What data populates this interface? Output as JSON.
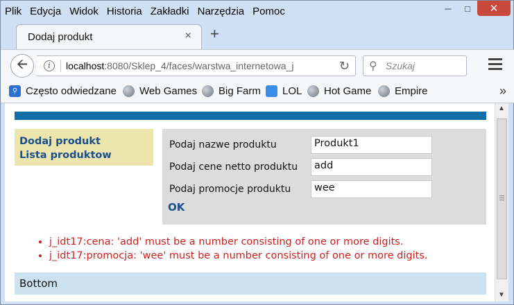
{
  "menu": [
    "Plik",
    "Edycja",
    "Widok",
    "Historia",
    "Zakładki",
    "Narzędzia",
    "Pomoc"
  ],
  "tab": {
    "title": "Dodaj produkt",
    "close": "×",
    "newtab": "+"
  },
  "nav": {
    "url_host": "localhost",
    "url_rest": ":8080/Sklep_4/faces/warstwa_internetowa_j",
    "search_placeholder": "Szukaj"
  },
  "bookmarks": [
    {
      "label": "Często odwiedzane",
      "icon": "bookmark-icon"
    },
    {
      "label": "Web Games",
      "icon": "globe-icon"
    },
    {
      "label": "Big Farm",
      "icon": "globe-icon"
    },
    {
      "label": "LOL",
      "icon": "smile-icon"
    },
    {
      "label": "Hot Game",
      "icon": "globe-icon"
    },
    {
      "label": "Empire",
      "icon": "globe-icon"
    }
  ],
  "sidebar": {
    "links": [
      "Dodaj produkt",
      "Lista produktow"
    ]
  },
  "form": {
    "fields": [
      {
        "label": "Podaj nazwe produktu",
        "value": "Produkt1"
      },
      {
        "label": "Podaj cene netto produktu",
        "value": "add"
      },
      {
        "label": "Podaj promocje produktu",
        "value": "wee"
      }
    ],
    "submit": "OK"
  },
  "errors": [
    "j_idt17:cena: 'add' must be a number consisting of one or more digits.",
    "j_idt17:promocja: 'wee' must be a number consisting of one or more digits."
  ],
  "footer": {
    "text": "Bottom"
  },
  "colors": {
    "accent_bar": "#106ea8",
    "sidebar_bg": "#ece6ae",
    "form_bg": "#dcdcdc",
    "error": "#d02020",
    "footer_bg": "#cde2f1",
    "link": "#1a4f8a"
  }
}
